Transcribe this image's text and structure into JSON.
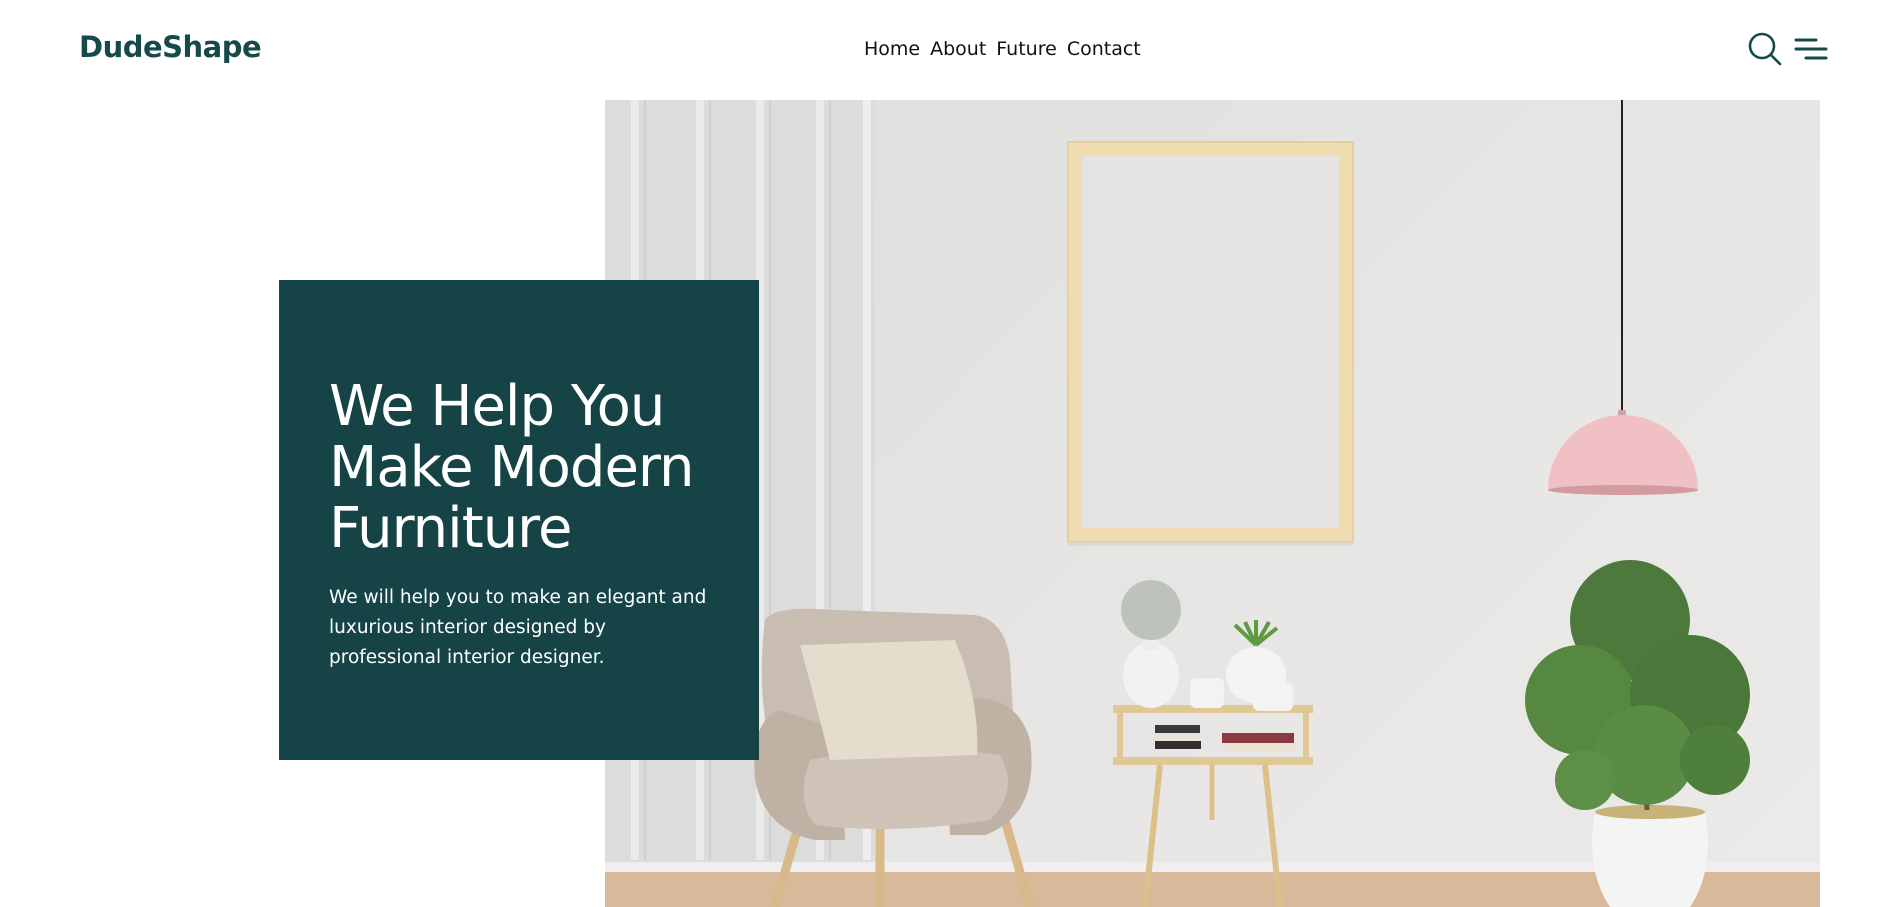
{
  "brand": {
    "name": "DudeShape",
    "color": "#16494a"
  },
  "nav": {
    "items": [
      {
        "label": "Home"
      },
      {
        "label": "About"
      },
      {
        "label": "Future"
      },
      {
        "label": "Contact"
      }
    ]
  },
  "header_icons": {
    "search": "search-icon",
    "menu": "menu-icon"
  },
  "hero": {
    "title_line1": "We Help You",
    "title_line2": "Make Modern",
    "title_line3": "Furniture",
    "description": "We will help you to make an elegant and luxurious interior designed by professional interior designer.",
    "card_color": "#164446"
  }
}
